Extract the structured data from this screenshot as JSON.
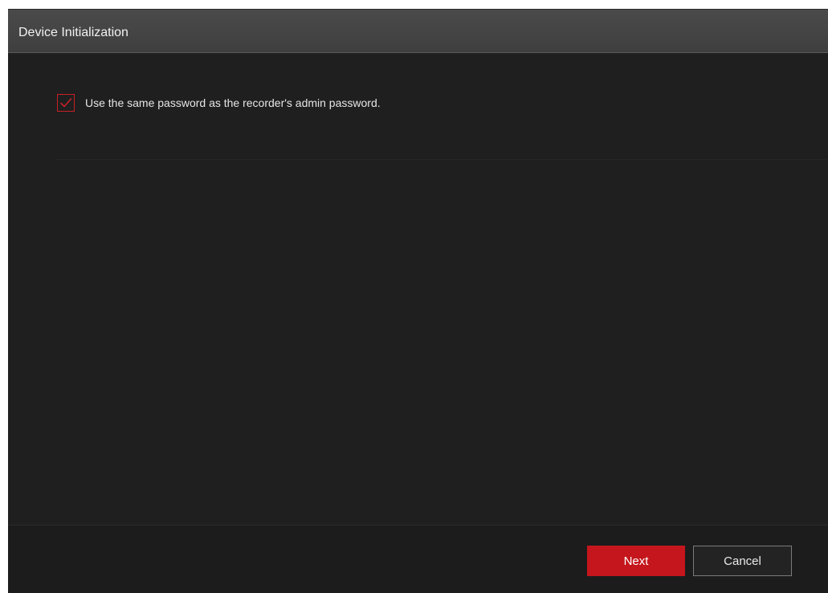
{
  "dialog": {
    "title": "Device Initialization"
  },
  "option": {
    "checked": true,
    "label": "Use the same password as the recorder's admin password."
  },
  "footer": {
    "next_label": "Next",
    "cancel_label": "Cancel"
  },
  "colors": {
    "accent": "#c4161c",
    "background": "#1f1f1f",
    "titlebar": "#444444"
  },
  "icons": {
    "checkbox": "checkmark-icon"
  }
}
